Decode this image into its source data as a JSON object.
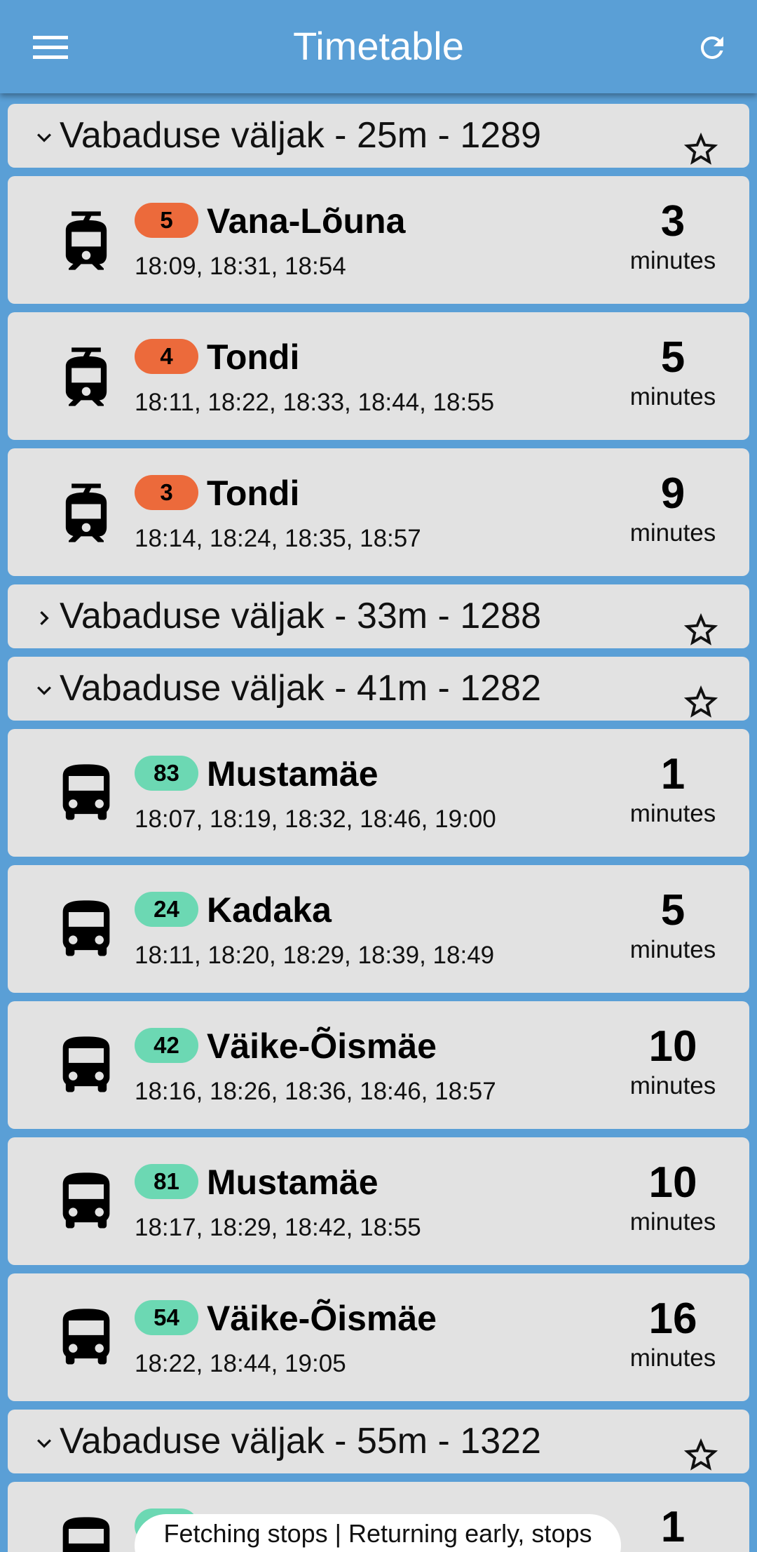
{
  "appbar": {
    "title": "Timetable",
    "menu_icon": "menu-icon",
    "refresh_icon": "refresh-icon"
  },
  "colors": {
    "background": "#5a9fd6",
    "card": "#e2e2e2",
    "tram_badge": "#ec6a3b",
    "bus_badge": "#6cd8b3"
  },
  "groups": [
    {
      "title": "Vabaduse väljak - 25m - 1289",
      "expanded": true,
      "routes": [
        {
          "type": "tram",
          "number": "5",
          "destination": "Vana-Lõuna",
          "times": "18:09, 18:31, 18:54",
          "minutes": "3",
          "unit": "minutes"
        },
        {
          "type": "tram",
          "number": "4",
          "destination": "Tondi",
          "times": "18:11, 18:22, 18:33, 18:44, 18:55",
          "minutes": "5",
          "unit": "minutes"
        },
        {
          "type": "tram",
          "number": "3",
          "destination": "Tondi",
          "times": "18:14, 18:24, 18:35, 18:57",
          "minutes": "9",
          "unit": "minutes"
        }
      ]
    },
    {
      "title": "Vabaduse väljak - 33m - 1288",
      "expanded": false,
      "routes": []
    },
    {
      "title": "Vabaduse väljak - 41m - 1282",
      "expanded": true,
      "routes": [
        {
          "type": "bus",
          "number": "83",
          "destination": "Mustamäe",
          "times": "18:07, 18:19, 18:32, 18:46, 19:00",
          "minutes": "1",
          "unit": "minutes"
        },
        {
          "type": "bus",
          "number": "24",
          "destination": "Kadaka",
          "times": "18:11, 18:20, 18:29, 18:39, 18:49",
          "minutes": "5",
          "unit": "minutes"
        },
        {
          "type": "bus",
          "number": "42",
          "destination": "Väike-Õismäe",
          "times": "18:16, 18:26, 18:36, 18:46, 18:57",
          "minutes": "10",
          "unit": "minutes"
        },
        {
          "type": "bus",
          "number": "81",
          "destination": "Mustamäe",
          "times": "18:17, 18:29, 18:42, 18:55",
          "minutes": "10",
          "unit": "minutes"
        },
        {
          "type": "bus",
          "number": "54",
          "destination": "Väike-Õismäe",
          "times": "18:22, 18:44, 19:05",
          "minutes": "16",
          "unit": "minutes"
        }
      ]
    },
    {
      "title": "Vabaduse väljak - 55m - 1322",
      "expanded": true,
      "routes": [
        {
          "type": "bus",
          "number": "",
          "destination": "",
          "times": "",
          "minutes": "1",
          "unit": ""
        }
      ]
    }
  ],
  "toast": {
    "text": "Fetching stops | Returning early, stops"
  }
}
